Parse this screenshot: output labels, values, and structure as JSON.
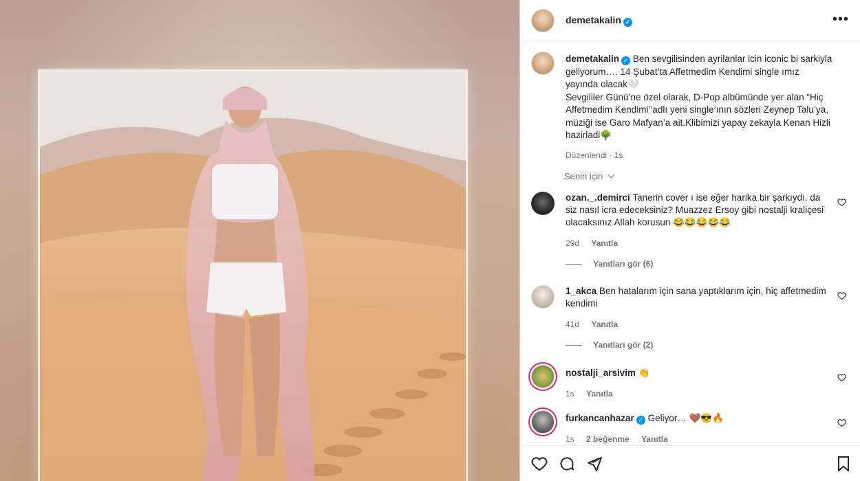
{
  "post": {
    "username": "demetakalin",
    "verified": true,
    "more_icon": "more-horizontal-icon"
  },
  "caption": {
    "username": "demetakalin",
    "text1": "Ben sevgilisinden ayrilanlar icin iconic bi sarkiyla geliyorum…. 14 Şubat’ta Affetmedim Kendimi single ımız yayında olacak🤍",
    "text2": "Sevgililer Günü’ne özel olarak, D-Pop albümünde yer alan “Hiç Affetmedim Kendimi’’adlı yeni single’ının sözleri Zeynep Talu’ya, müziği ise Garo Mafyan’a ait.Klibimizi yapay zekayla Kenan Hizli hazirladi🌳",
    "edited": "Düzenlendi",
    "age": "1s"
  },
  "filter": {
    "label": "Senin için"
  },
  "comments": [
    {
      "username": "ozan._.demirci",
      "text": "Tanerin cover ı ise eğer harika bir şarkıydı, da siz nasıl icra edeceksiniz? Muazzez Ersoy gibi nostalji kraliçesi olacaksınız Allah korusun 😂😂😂😂😂",
      "age": "29d",
      "reply": "Yanıtla",
      "view_replies": "Yanıtları gör (6)"
    },
    {
      "username": "1_akca",
      "text": "Ben hatalarım için sana yaptıklarım için, hiç affetmedim kendimi",
      "age": "41d",
      "reply": "Yanıtla",
      "view_replies": "Yanıtları gör (2)"
    },
    {
      "username": "nostalji_arsivim",
      "text": "👏",
      "age": "1s",
      "reply": "Yanıtla"
    },
    {
      "username": "furkancanhazar",
      "text": "Geliyor… 🤎😎🔥",
      "age": "1s",
      "likes": "2 beğenme",
      "reply": "Yanıtla"
    }
  ],
  "actions": [
    "heart-icon",
    "comment-icon",
    "share-icon",
    "bookmark-icon"
  ]
}
